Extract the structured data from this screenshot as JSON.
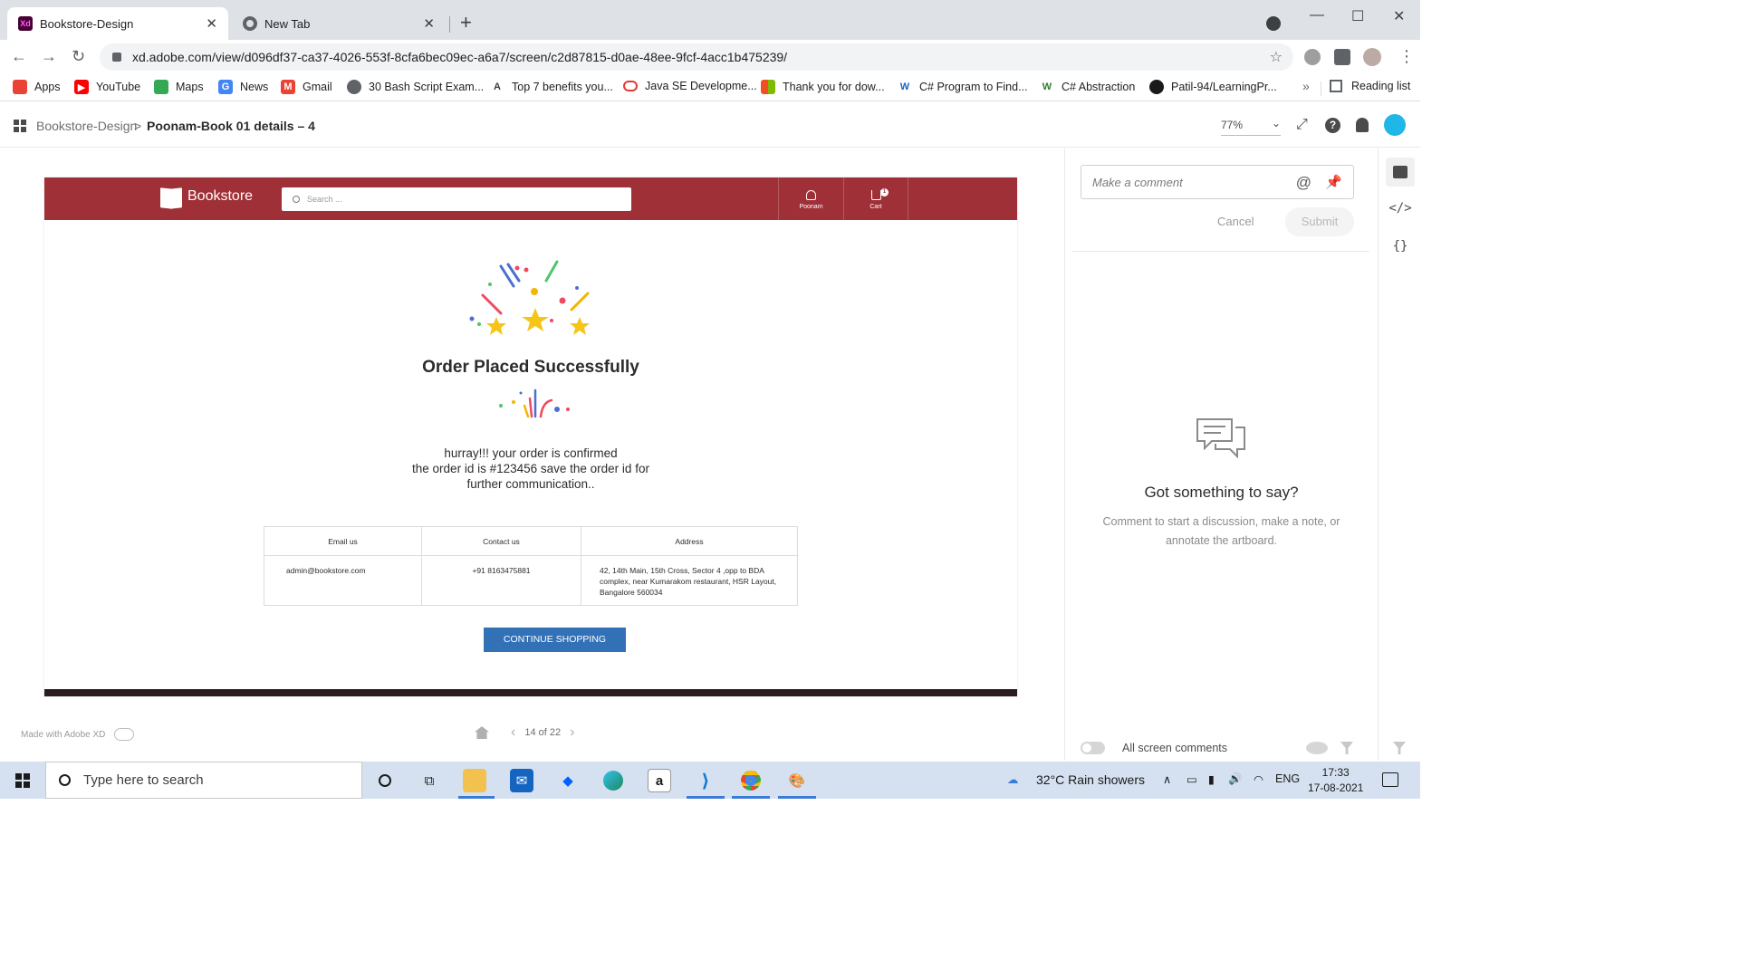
{
  "browser": {
    "tabs": [
      {
        "title": "Bookstore-Design",
        "active": true,
        "icon": "adobe-xd-icon"
      },
      {
        "title": "New Tab",
        "active": false,
        "icon": "chrome-icon"
      }
    ],
    "url": "xd.adobe.com/view/d096df37-ca37-4026-553f-8cfa6bec09ec-a6a7/screen/c2d87815-d0ae-48ee-9fcf-4acc1b475239/",
    "bookmarks": [
      {
        "label": "Apps",
        "icon": "apps-grid-icon",
        "color": "#ea4335"
      },
      {
        "label": "YouTube",
        "icon": "youtube-icon",
        "color": "#ff0000"
      },
      {
        "label": "Maps",
        "icon": "maps-icon",
        "color": "#34a853"
      },
      {
        "label": "News",
        "icon": "news-icon",
        "color": "#4285f4"
      },
      {
        "label": "Gmail",
        "icon": "gmail-icon",
        "color": "#ea4335"
      },
      {
        "label": "30 Bash Script Exam...",
        "icon": "globe-icon",
        "color": "#5f6368"
      },
      {
        "label": "Top 7 benefits you...",
        "icon": "a-icon",
        "color": "#3c3c3c"
      },
      {
        "label": "Java SE Developme...",
        "icon": "oracle-icon",
        "color": "#e53935"
      },
      {
        "label": "Thank you for dow...",
        "icon": "microsoft-icon",
        "color": "#f25022"
      },
      {
        "label": "C# Program to Find...",
        "icon": "w-icon",
        "color": "#1565c0"
      },
      {
        "label": "C# Abstraction",
        "icon": "w3-icon",
        "color": "#2e7d32"
      },
      {
        "label": "Patil-94/LearningPr...",
        "icon": "github-icon",
        "color": "#1a1a1a"
      }
    ],
    "overflow": "»",
    "reading_list": "Reading list"
  },
  "xd": {
    "breadcrumb_parent": "Bookstore-Design",
    "breadcrumb_sep": ">",
    "breadcrumb_current": "Poonam-Book 01 details – 4",
    "zoom": "77%",
    "made_with": "Made with Adobe XD",
    "pager": "14 of 22"
  },
  "artboard": {
    "brand": "Bookstore",
    "search_placeholder": "Search ...",
    "nav_user": "Poonam",
    "nav_cart": "Cart",
    "cart_count": "1",
    "title": "Order Placed Successfully",
    "message_line1": "hurray!!! your order is confirmed",
    "message_line2": "the order id is #123456 save the order id for",
    "message_line3": "further communication..",
    "table_headers": [
      "Email us",
      "Contact us",
      "Address"
    ],
    "email": "admin@bookstore.com",
    "phone": "+91 8163475881",
    "address": "42, 14th Main, 15th Cross, Sector 4 ,opp to BDA complex, near Kumarakom restaurant, HSR Layout, Bangalore 560034",
    "button": "CONTINUE SHOPPING",
    "header_color": "#a03037",
    "button_color": "#3371b7"
  },
  "comments": {
    "placeholder": "Make a comment",
    "cancel": "Cancel",
    "submit": "Submit",
    "empty_title": "Got something to say?",
    "empty_hint": "Comment to start a discussion, make a note, or annotate the artboard.",
    "all_screen": "All screen comments"
  },
  "taskbar": {
    "search": "Type here to search",
    "weather": "32°C  Rain showers",
    "language": "ENG",
    "time": "17:33",
    "date": "17-08-2021"
  }
}
